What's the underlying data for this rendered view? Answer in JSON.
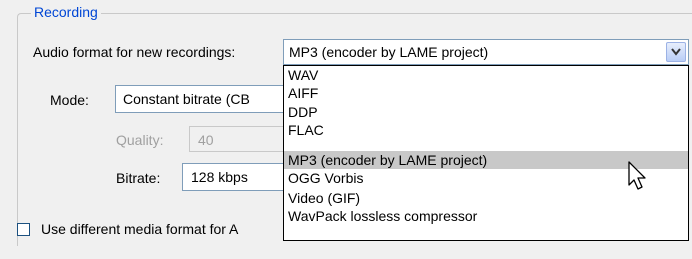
{
  "group": {
    "title": "Recording"
  },
  "audio_format": {
    "label": "Audio format for new recordings:",
    "selected": "MP3 (encoder by LAME project)",
    "options": [
      "WAV",
      "AIFF",
      "DDP",
      "FLAC",
      "MP3 (encoder by LAME project)",
      "OGG Vorbis",
      "Video (GIF)",
      "WavPack lossless compressor"
    ],
    "highlighted_index": 4
  },
  "mode": {
    "label": "Mode:",
    "value": "Constant bitrate  (CB"
  },
  "quality": {
    "label": "Quality:",
    "value": "40"
  },
  "bitrate": {
    "label": "Bitrate:",
    "value": "128 kbps"
  },
  "use_different": {
    "label": "Use different media format for A",
    "checked": false
  },
  "icons": {
    "dropdown_arrow": "chevron-down-icon",
    "cursor": "mouse-pointer-icon"
  },
  "colors": {
    "legend": "#0046d5",
    "highlight": "#c8c8c8"
  }
}
